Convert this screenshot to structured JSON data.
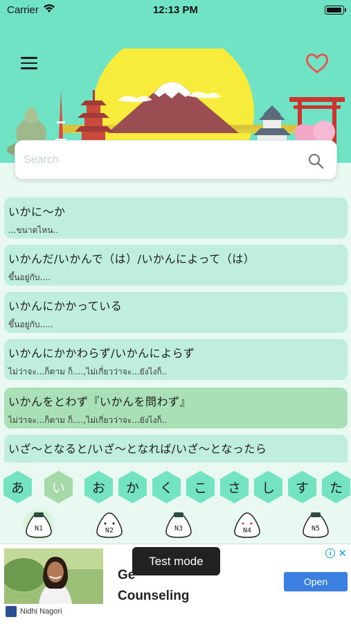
{
  "status_bar": {
    "carrier": "Carrier",
    "time": "12:13 PM"
  },
  "search": {
    "placeholder": "Search"
  },
  "grammar_list": [
    {
      "title": "いかに～か",
      "meaning": "...ขนาดไหน.."
    },
    {
      "title": "いかんだ/いかんで（は）/いかんによって（は）",
      "meaning": "ขึ้นอยู่กับ...."
    },
    {
      "title": "いかんにかかっている",
      "meaning": "ขึ้นอยู่กับ....."
    },
    {
      "title": "いかんにかかわらず/いかんによらず",
      "meaning": "ไม่ว่าจะ...ก็ตาม ก็....,ไม่เกี่ยวว่าจะ...ยังไงก็.."
    },
    {
      "title": "いかんをとわず『いかんを問わず』",
      "meaning": "ไม่ว่าจะ...ก็ตาม ก็....,ไม่เกี่ยวว่าจะ...ยังไงก็..",
      "selected": true
    },
    {
      "title": "いざ～となると/いざ～となれば/いざ～となったら",
      "meaning": "...(...)..."
    }
  ],
  "kana_tabs": [
    "あ",
    "い",
    "お",
    "か",
    "く",
    "こ",
    "さ",
    "し",
    "す",
    "た"
  ],
  "active_kana": "い",
  "levels": [
    "N1",
    "N2",
    "N3",
    "N4",
    "N5"
  ],
  "active_level": "N1",
  "ad": {
    "headline": "Ge... Counseling",
    "headline_line2": "Counseling",
    "headline_line1": "Ge",
    "advertiser": "Nidhi Nagori",
    "cta": "Open",
    "toast": "Test mode"
  },
  "colors": {
    "header": "#6fe3c4",
    "item": "#bfeedd",
    "item_selected": "#a9e0b6",
    "hex": "#74e3c2",
    "hex_active": "#a6d9a8",
    "heart": "#e05a4f"
  }
}
